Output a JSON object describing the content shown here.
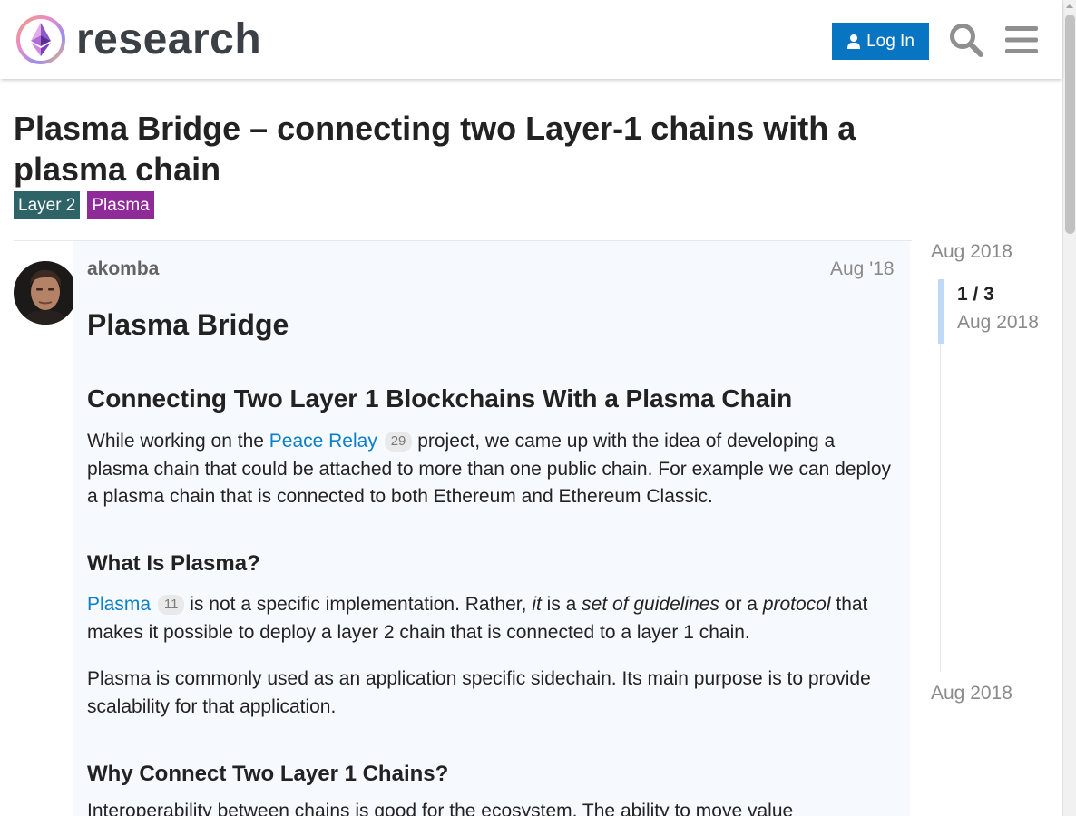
{
  "header": {
    "logo_text": "research",
    "login_label": "Log In"
  },
  "topic": {
    "title": "Plasma Bridge – connecting two Layer-1 chains with a plasma chain",
    "tags": [
      {
        "label": "Layer 2",
        "color": "#2e6368"
      },
      {
        "label": "Plasma",
        "color": "#8f2a99"
      }
    ]
  },
  "post": {
    "username": "akomba",
    "date": "Aug '18",
    "heading1": "Plasma Bridge",
    "heading2": "Connecting Two Layer 1 Blockchains With a Plasma Chain",
    "p1": {
      "before": "While working on the ",
      "link": "Peace Relay",
      "clicks": "29",
      "after": " project, we came up with the idea of developing a plasma chain that could be attached to more than one public chain. For example we can deploy a plasma chain that is connected to both Ethereum and Ethereum Classic."
    },
    "heading3a": "What Is Plasma?",
    "p2": {
      "link": "Plasma",
      "clicks": "11",
      "t1": " is not a specific implementation. Rather, ",
      "em1": "it",
      "t2": " is a ",
      "em2": "set of guidelines",
      "t3": " or a ",
      "em3": "protocol",
      "t4": " that makes it possible to deploy a layer 2 chain that is connected to a layer 1 chain."
    },
    "p3": "Plasma is commonly used as an application specific sidechain. Its main purpose is to provide scalability for that application.",
    "heading3b": "Why Connect Two Layer 1 Chains?",
    "p4": "Interoperability between chains is good for the ecosystem. The ability to move value"
  },
  "timeline": {
    "top_date": "Aug 2018",
    "position": "1 / 3",
    "position_date": "Aug 2018",
    "bottom_date": "Aug 2018"
  },
  "colors": {
    "accent": "#0875c2",
    "link": "#0b7fc7",
    "post_bg": "#f6f9fd"
  }
}
